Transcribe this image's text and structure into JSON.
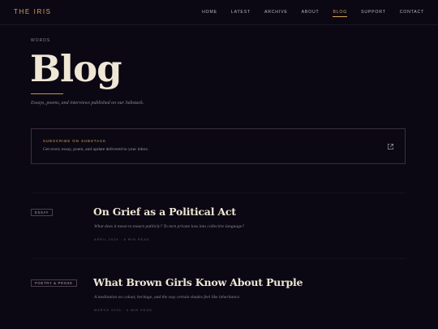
{
  "nav": {
    "brand": "THE IRIS",
    "links": [
      {
        "label": "HOME"
      },
      {
        "label": "LATEST"
      },
      {
        "label": "ARCHIVE"
      },
      {
        "label": "ABOUT"
      },
      {
        "label": "BLOG",
        "active": true
      },
      {
        "label": "SUPPORT"
      },
      {
        "label": "CONTACT"
      }
    ]
  },
  "header": {
    "eyebrow": "WORDS",
    "title": "Blog",
    "subtitle": "Essays, poems, and interviews published on our Substack."
  },
  "subscribe": {
    "title": "SUBSCRIBE ON SUBSTACK",
    "text": "Get every essay, poem, and update delivered to your inbox.",
    "icon": "external-link-icon"
  },
  "posts": [
    {
      "tag": "ESSAY",
      "title": "On Grief as a Political Act",
      "dek": "What does it mean to mourn publicly? To turn private loss into collective language?",
      "meta": "APRIL 2026 · 6 MIN READ"
    },
    {
      "tag": "POETRY & PROSE",
      "title": "What Brown Girls Know About Purple",
      "dek": "A meditation on colour, heritage, and the way certain shades feel like inheritance.",
      "meta": "MARCH 2026 · 4 MIN READ"
    }
  ],
  "colors": {
    "background": "#0b0813",
    "accent": "#d6a25a",
    "heading": "#efe6d6",
    "muted": "#8d8593"
  }
}
